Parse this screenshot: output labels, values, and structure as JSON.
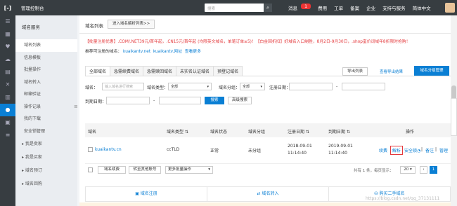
{
  "topbar": {
    "console_title": "管理控制台",
    "search_placeholder": "搜索",
    "nav": [
      "消息",
      "费用",
      "工单",
      "备案",
      "企业",
      "支持与服务",
      "简体中文"
    ],
    "message_badge": "1"
  },
  "sidebar": {
    "section_title": "域名服务",
    "items": [
      "域名列表",
      "信息模板",
      "批量操作",
      "域名转入",
      "邮箱验证",
      "操作记录",
      "我的下载",
      "安全锁管理"
    ],
    "groups": [
      "我是卖家",
      "我是买家",
      "域名预订",
      "域名回购"
    ]
  },
  "header": {
    "title": "域名列表",
    "switch_button": "进入域名解析列表>>"
  },
  "notice": "【批量注册优惠】.COM/.NET39元/首年起，.CN15元/首年起 (均限英文域名，单笔订单≥5)！【白金回折扣】好域名入口制胜，8月2日-9月30日，.shop蛮价词域年8折限时抢购！",
  "recommend": {
    "prefix": "推荐可注册的域名：",
    "links": [
      "kuaikantv.net",
      "kuaikantv.网址"
    ],
    "more": "查看更多"
  },
  "tabs": [
    "全部域名",
    "急需续费域名",
    "急需赎回域名",
    "未实名认证域名",
    "预登记域名"
  ],
  "toolbar": {
    "export_button": "导出列表",
    "export_result_link": "查看导出结果",
    "group_mgmt_button": "域名分组管理"
  },
  "filters": {
    "domain_label": "域名：",
    "domain_placeholder": "输入域名进行搜索",
    "type_label": "域名类型：",
    "type_value": "全部",
    "group_label": "域名分组：",
    "group_value": "全部",
    "reg_date_label": "注册日期：",
    "reg_sep": "-",
    "exp_date_label": "到期日期：",
    "exp_sep": "-",
    "search_button": "搜索",
    "advanced_button": "高级搜索"
  },
  "table": {
    "headers": [
      "域名",
      "域名类型",
      "域名状态",
      "域名分组",
      "注册日期",
      "到期日期",
      "操作"
    ],
    "rows": [
      {
        "domain": "kuaikantv.cn",
        "type": "ccTLD",
        "status": "正常",
        "group": "未分组",
        "reg_date": "2018-09-01",
        "reg_time": "11:14:40",
        "exp_date": "2019-09-01",
        "exp_time": "11:14:40",
        "actions": [
          "续费",
          "解析",
          "安全锁",
          "|",
          "备注",
          "|",
          "管理"
        ]
      }
    ]
  },
  "bottom": {
    "renew_button": "域名续费",
    "transfer_button": "转至其他账号",
    "batch_select": "更多批量操作",
    "pager_text": "共有 1 条，每页显示：",
    "page_size": "20",
    "current_page": "1"
  },
  "quick_links": [
    "域名注册",
    "域名转入",
    "购买二手域名"
  ],
  "watermark": "https://blog.csdn.net/qq_37131111"
}
